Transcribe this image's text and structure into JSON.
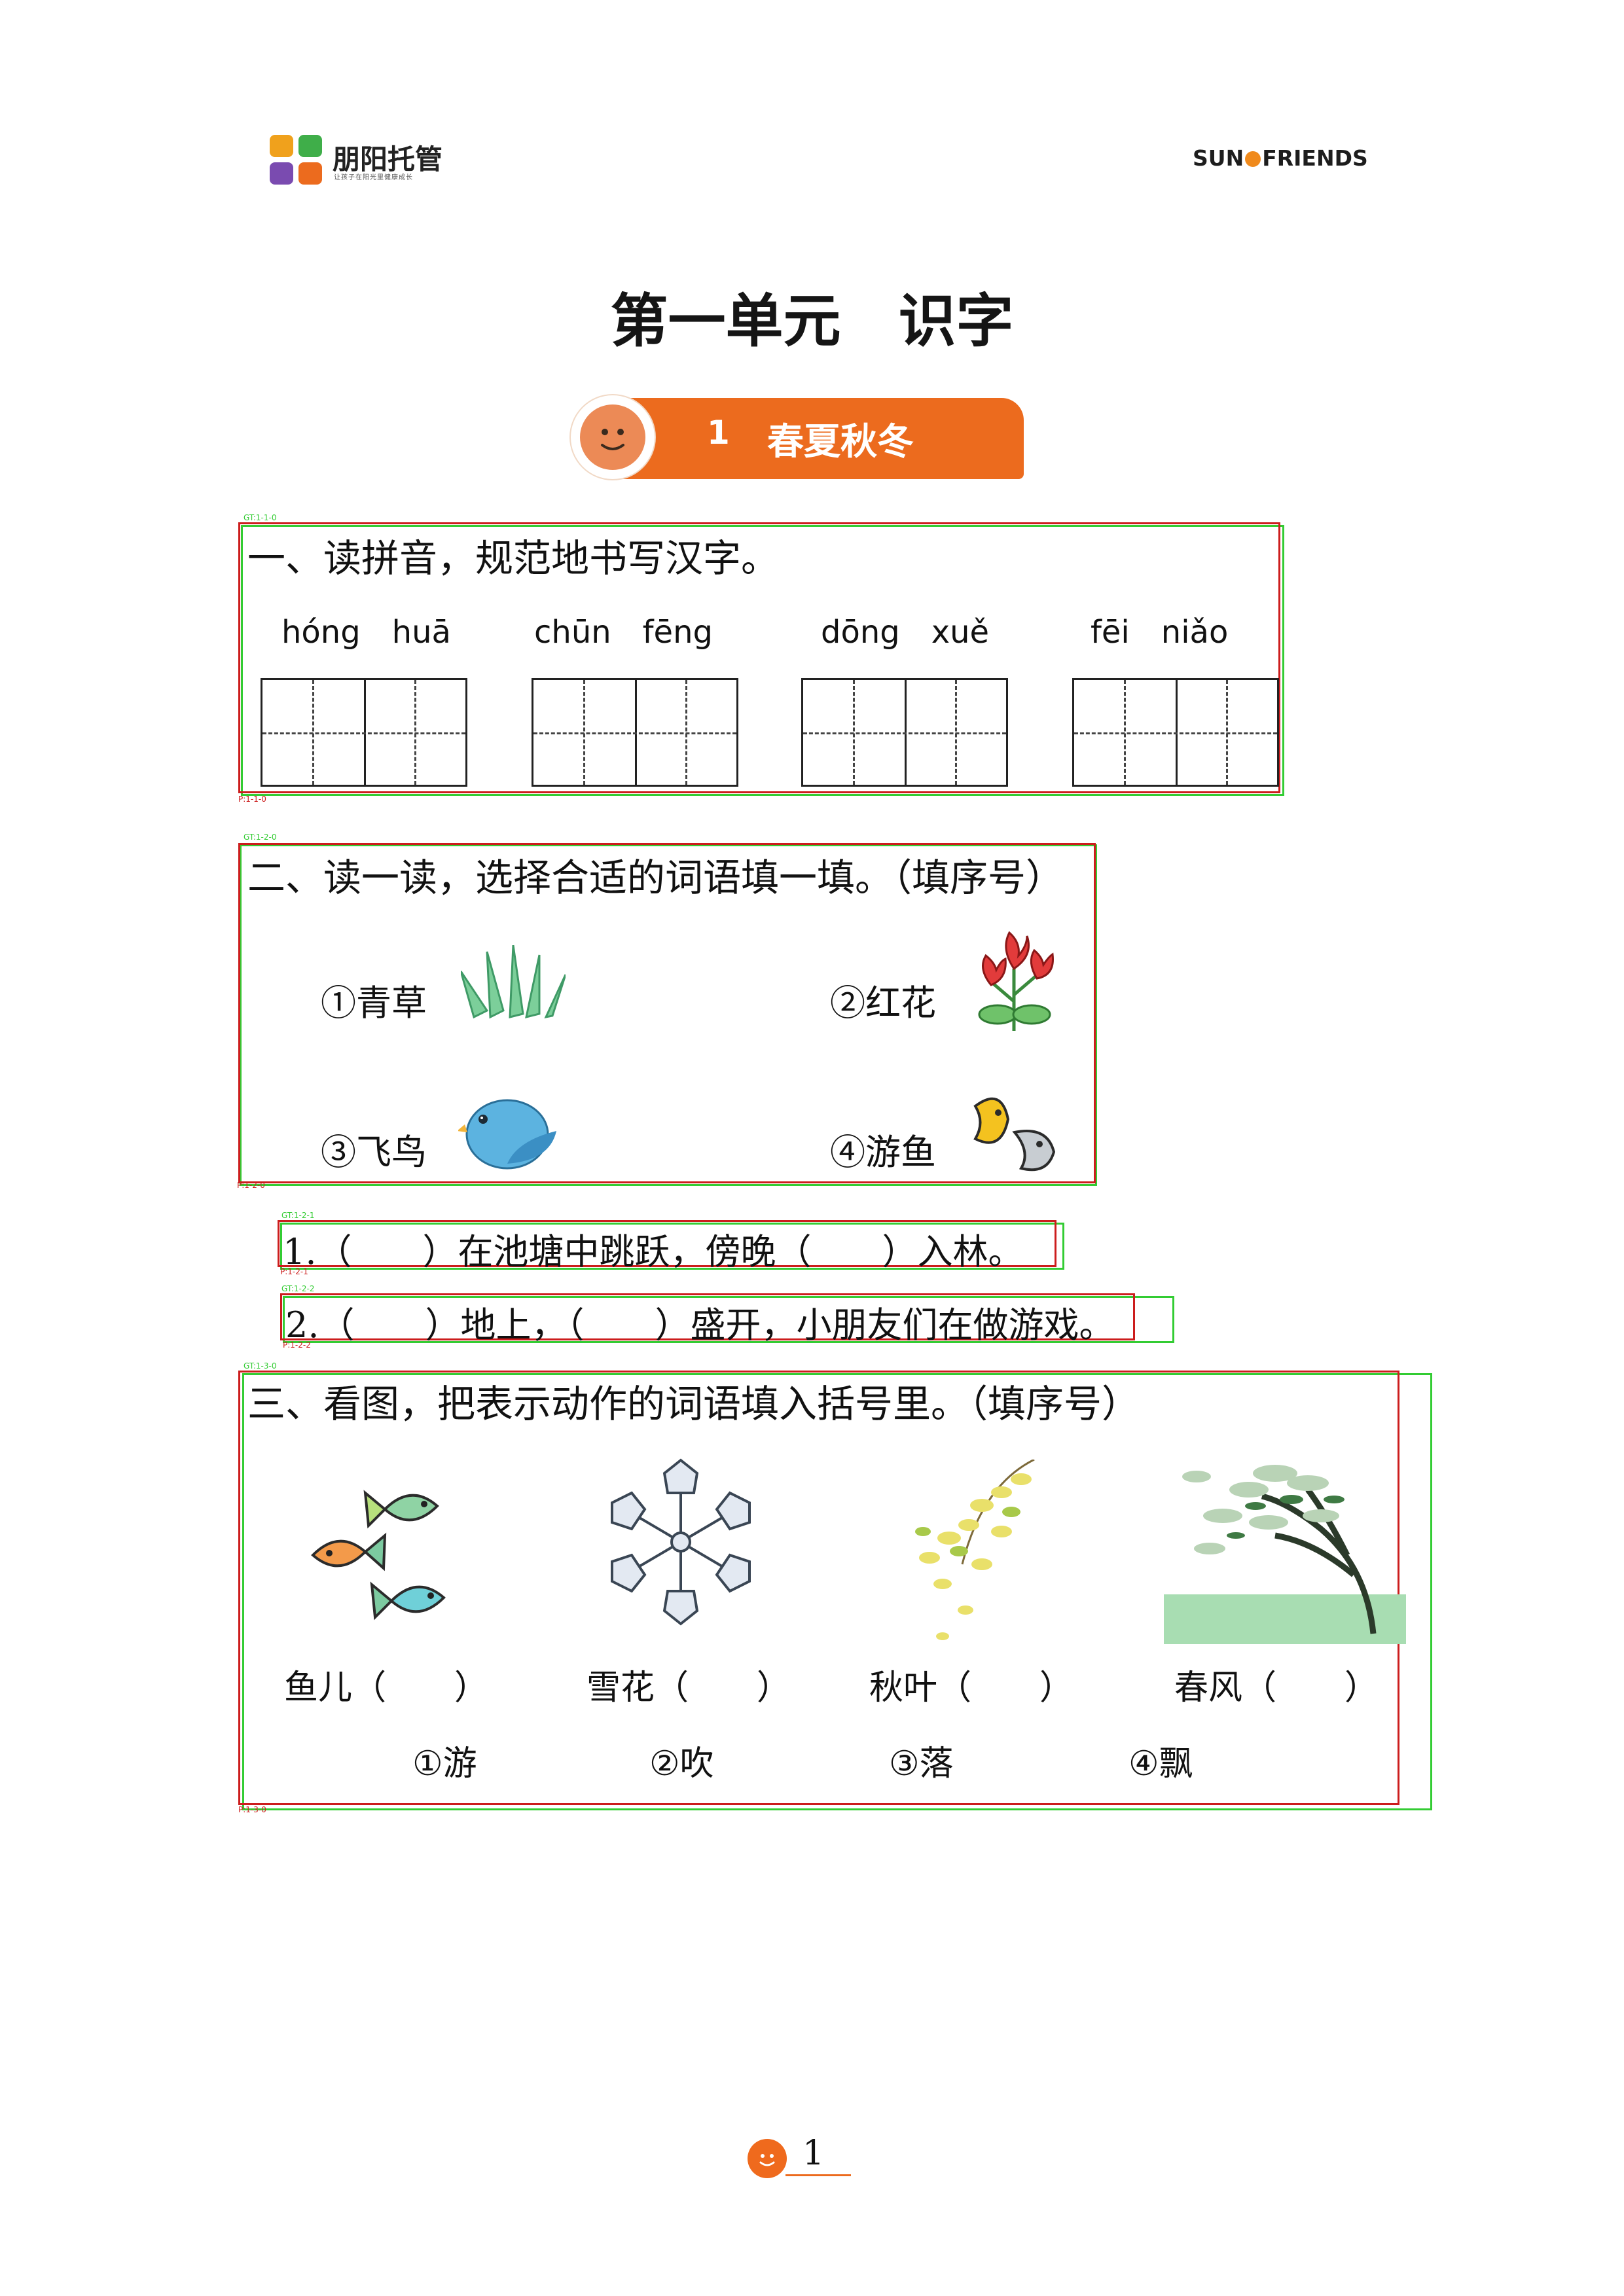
{
  "header": {
    "logo_name": "朋阳托管",
    "logo_tagline": "让孩子在阳光里健康成长",
    "brand_left": "SUN",
    "brand_right": "FRIENDS",
    "colors": {
      "accent": "#ec6b1e",
      "logo": [
        "#f0a11c",
        "#3fae49",
        "#7a4bb0",
        "#ec6b1e"
      ]
    }
  },
  "page_title": "第一单元　识字",
  "lesson": {
    "number": "1",
    "name": "春夏秋冬",
    "icon": "smiley-face-icon"
  },
  "annotation_tags": {
    "s1_gt": "GT:1-1-0",
    "s1_pr": "P:1-1-0",
    "s2_gt": "GT:1-2-0",
    "s2_pr": "P:1-2-0",
    "q1_gt": "GT:1-2-1",
    "q1_pr": "P:1-2-1",
    "q2_gt": "GT:1-2-2",
    "q2_pr": "P:1-2-2",
    "s3_gt": "GT:1-3-0",
    "s3_pr": "P:1-3-0"
  },
  "section1": {
    "title": "一、读拼音，规范地书写汉字。",
    "pinyin": [
      "hóng　huā",
      "chūn　fēng",
      "dōng　xuě",
      "fēi　niǎo"
    ]
  },
  "section2": {
    "title": "二、读一读，选择合适的词语填一填。（填序号）",
    "options": [
      {
        "label": "①青草",
        "icon": "grass-icon"
      },
      {
        "label": "②红花",
        "icon": "red-flower-icon"
      },
      {
        "label": "③飞鸟",
        "icon": "bird-icon"
      },
      {
        "label": "④游鱼",
        "icon": "fish-icon"
      }
    ],
    "questions": [
      "1.（　　）在池塘中跳跃，傍晚（　　）入林。",
      "2.（　　）地上，（　　）盛开，小朋友们在做游戏。"
    ]
  },
  "section3": {
    "title": "三、看图，把表示动作的词语填入括号里。（填序号）",
    "pictures": [
      "fish-group-icon",
      "snowflake-icon",
      "falling-leaves-icon",
      "windy-tree-icon"
    ],
    "blanks": [
      "鱼儿（　　）",
      "雪花（　　）",
      "秋叶（　　）",
      "春风（　　）"
    ],
    "verbs": [
      "①游",
      "②吹",
      "③落",
      "④飘"
    ]
  },
  "footer": {
    "page_number": "1"
  }
}
